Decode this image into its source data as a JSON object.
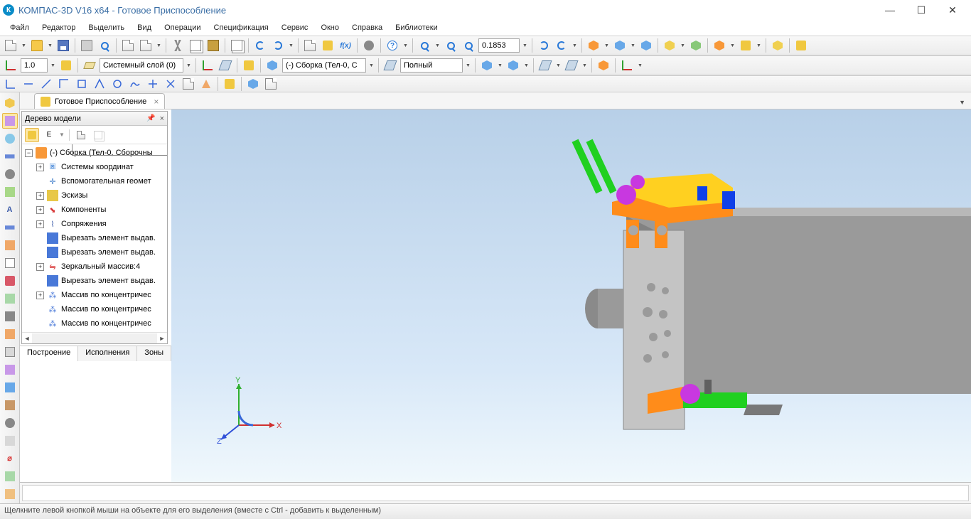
{
  "app": {
    "title": "КОМПАС-3D V16  x64 - Готовое Приспособление"
  },
  "menu": [
    "Файл",
    "Редактор",
    "Выделить",
    "Вид",
    "Операции",
    "Спецификация",
    "Сервис",
    "Окно",
    "Справка",
    "Библиотеки"
  ],
  "toolbar1": {
    "zoom": "0.1853"
  },
  "toolbar2": {
    "scale": "1.0",
    "layer": "Системный слой (0)",
    "assembly": "(-) Сборка (Тел-0, С",
    "style": "Полный"
  },
  "doc_tab": {
    "label": "Готовое Приспособление"
  },
  "tree": {
    "title": "Дерево модели",
    "root": "(-) Сборка (Тел-0, Сборочны",
    "nodes": [
      {
        "exp": "+",
        "icon": "cs",
        "label": "Системы координат"
      },
      {
        "exp": "",
        "icon": "aux",
        "label": "Вспомогательная геомет"
      },
      {
        "exp": "+",
        "icon": "sk",
        "label": "Эскизы"
      },
      {
        "exp": "+",
        "icon": "comp",
        "label": "Компоненты"
      },
      {
        "exp": "+",
        "icon": "mate",
        "label": "Сопряжения"
      },
      {
        "exp": "",
        "icon": "cut",
        "label": "Вырезать элемент выдав."
      },
      {
        "exp": "",
        "icon": "cut",
        "label": "Вырезать элемент выдав."
      },
      {
        "exp": "+",
        "icon": "mirror",
        "label": "Зеркальный массив:4"
      },
      {
        "exp": "",
        "icon": "cut",
        "label": "Вырезать элемент выдав."
      },
      {
        "exp": "+",
        "icon": "arr",
        "label": "Массив по концентричес"
      },
      {
        "exp": "",
        "icon": "arr",
        "label": "Массив по концентричес"
      },
      {
        "exp": "",
        "icon": "arr",
        "label": "Массив по концентричес"
      }
    ]
  },
  "bottom_tabs": [
    "Построение",
    "Исполнения",
    "Зоны"
  ],
  "status": "Щелкните левой кнопкой мыши на объекте для его выделения (вместе с Ctrl - добавить к выделенным)"
}
